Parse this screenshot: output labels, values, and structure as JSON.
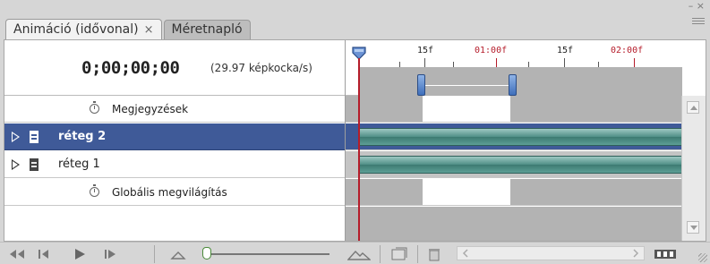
{
  "tabs": [
    {
      "label": "Animáció (idővonal)",
      "close": "×",
      "active": true
    },
    {
      "label": "Méretnapló",
      "active": false
    }
  ],
  "window": {
    "minimize": "–",
    "close": "×",
    "menu_icon": "panel-menu-icon"
  },
  "timeline": {
    "timecode": "0;00;00;00",
    "fps": "(29.97 képkocka/s)",
    "ruler_labels": [
      {
        "text": "15f",
        "color": "#333333"
      },
      {
        "text": "01:00f",
        "color": "#b51c2a"
      },
      {
        "text": "15f",
        "color": "#333333"
      },
      {
        "text": "02:00f",
        "color": "#b51c2a"
      }
    ]
  },
  "rows": [
    {
      "label": "Megjegyzések",
      "type": "property"
    },
    {
      "label": "réteg 2",
      "type": "layer",
      "selected": true
    },
    {
      "label": "réteg 1",
      "type": "layer",
      "selected": false
    },
    {
      "label": "Globális megvilágítás",
      "type": "property"
    }
  ],
  "toolbar": {
    "icons": [
      "first-frame-icon",
      "previous-frame-icon",
      "play-icon",
      "next-frame-icon",
      "zoom-out-mountain-icon",
      "zoom-in-mountain-icon",
      "new-frames-icon",
      "trash-icon",
      "scroll-left-icon",
      "scroll-right-icon",
      "frame-animation-icon"
    ]
  },
  "colors": {
    "selected_row": "#3f5a98",
    "playhead": "#b51c2a",
    "layer_bar": "#4f8e86",
    "work_area_handle": "#3f6fbb"
  }
}
